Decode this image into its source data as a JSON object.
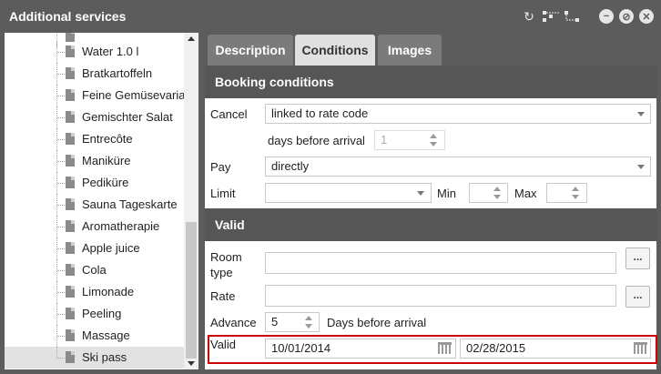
{
  "window": {
    "title": "Additional services"
  },
  "titlebar_icons": [
    "refresh-icon",
    "tree-expand-icon",
    "tree-collapse-icon",
    "minimize-icon",
    "help-icon",
    "close-icon"
  ],
  "tree": {
    "items": [
      {
        "label": "Water 1.0 l"
      },
      {
        "label": "Bratkartoffeln"
      },
      {
        "label": "Feine Gemüsevariat"
      },
      {
        "label": "Gemischter Salat"
      },
      {
        "label": "Entrecôte"
      },
      {
        "label": "Maniküre"
      },
      {
        "label": "Pediküre"
      },
      {
        "label": "Sauna Tageskarte"
      },
      {
        "label": "Aromatherapie"
      },
      {
        "label": "Apple juice"
      },
      {
        "label": "Cola"
      },
      {
        "label": "Limonade"
      },
      {
        "label": "Peeling"
      },
      {
        "label": "Massage"
      },
      {
        "label": "Ski pass",
        "selected": true
      }
    ]
  },
  "tabs": [
    {
      "label": "Description"
    },
    {
      "label": "Conditions",
      "active": true
    },
    {
      "label": "Images"
    }
  ],
  "booking": {
    "heading": "Booking conditions",
    "cancel_label": "Cancel",
    "cancel_value": "linked to rate code",
    "days_before_label": "days before arrival",
    "days_before_value": "1",
    "pay_label": "Pay",
    "pay_value": "directly",
    "limit_label": "Limit",
    "limit_value": "",
    "min_label": "Min",
    "min_value": "",
    "max_label": "Max",
    "max_value": ""
  },
  "valid": {
    "heading": "Valid",
    "room_type_label_1": "Room",
    "room_type_label_2": "type",
    "room_type_value": "",
    "rate_label": "Rate",
    "rate_value": "",
    "browse_label": "...",
    "advance_label": "Advance",
    "advance_value": "5",
    "advance_suffix": "Days before arrival",
    "valid_label": "Valid",
    "valid_from": "10/01/2014",
    "valid_to": "02/28/2015"
  }
}
